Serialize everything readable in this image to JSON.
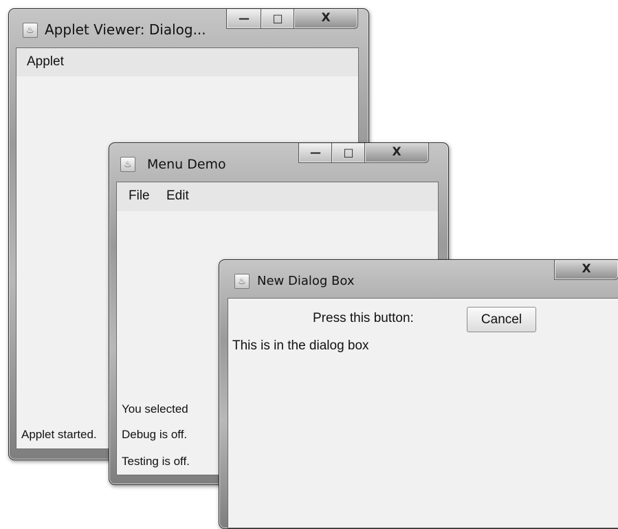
{
  "applet_viewer": {
    "title": "Applet Viewer: Dialog...",
    "menu": [
      "Applet"
    ],
    "status": "Applet started.",
    "caption": {
      "minimize": "—",
      "maximize": "□",
      "close": "X"
    }
  },
  "menu_demo": {
    "title": "Menu Demo",
    "menu": [
      "File",
      "Edit"
    ],
    "lines": [
      "You selected",
      "Debug is off.",
      "Testing is off."
    ],
    "caption": {
      "minimize": "—",
      "maximize": "□",
      "close": "X"
    }
  },
  "dialog": {
    "title": "New Dialog Box",
    "label": "Press this button:",
    "button": "Cancel",
    "message": "This is in the dialog box",
    "caption": {
      "close": "X"
    }
  }
}
